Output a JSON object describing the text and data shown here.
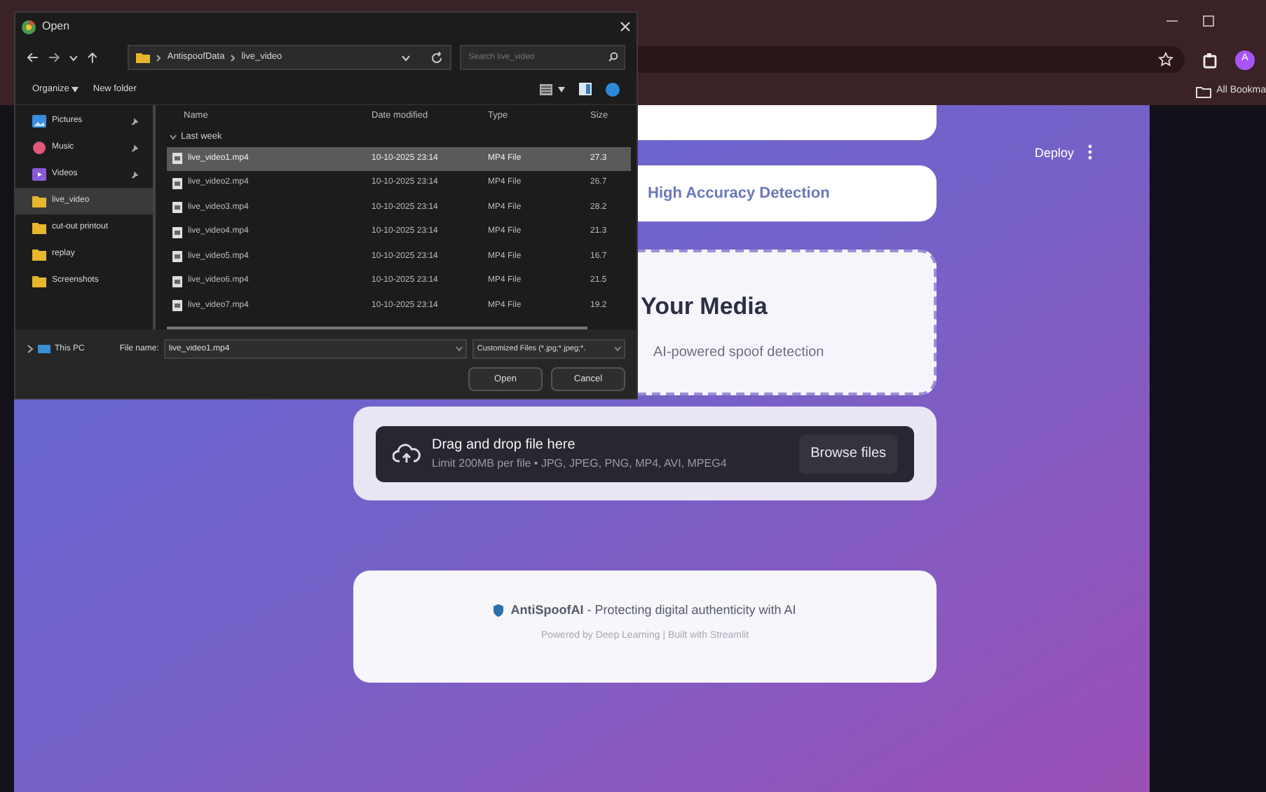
{
  "browser": {
    "bookmarks": "All Bookma",
    "profile": "A"
  },
  "app": {
    "deploy": "Deploy",
    "feature": "High Accuracy Detection",
    "upload_title": "Your Media",
    "upload_subtitle": "AI-powered spoof detection",
    "dropzone": {
      "title": "Drag and drop file here",
      "hint": "Limit 200MB per file • JPG, JPEG, PNG, MP4, AVI, MPEG4",
      "button": "Browse files"
    },
    "footer": {
      "line": "**AntiSpoofAI** - Protecting digital authenticity with AI",
      "credits": "Powered by Deep Learning | Built with Streamlit"
    }
  },
  "dialog": {
    "title": "Open",
    "breadcrumb": [
      "AntispoofData",
      "live_video"
    ],
    "search": {
      "placeholder": "Search live_video"
    },
    "toolbar": {
      "organize": "Organize",
      "new_folder": "New folder"
    },
    "nav": [
      {
        "label": "Pictures",
        "kind": "pictures",
        "pinned": true,
        "selected": false
      },
      {
        "label": "Music",
        "kind": "music",
        "pinned": true,
        "selected": false
      },
      {
        "label": "Videos",
        "kind": "videos",
        "pinned": true,
        "selected": false
      },
      {
        "label": "live_video",
        "kind": "folder",
        "pinned": false,
        "selected": true
      },
      {
        "label": "cut-out printout",
        "kind": "folder",
        "pinned": false,
        "selected": false
      },
      {
        "label": "replay",
        "kind": "folder",
        "pinned": false,
        "selected": false
      },
      {
        "label": "Screenshots",
        "kind": "folder",
        "pinned": false,
        "selected": false
      }
    ],
    "this_pc": {
      "label": "This PC",
      "expanded": false
    },
    "columns": [
      "Name",
      "Date modified",
      "Type",
      "Size"
    ],
    "group": "Last week",
    "files": [
      {
        "name": "live_video1.mp4",
        "date": "10-10-2025 23:14",
        "type": "MP4 File",
        "size": "27.3",
        "selected": true
      },
      {
        "name": "live_video2.mp4",
        "date": "10-10-2025 23:14",
        "type": "MP4 File",
        "size": "26.7",
        "selected": false
      },
      {
        "name": "live_video3.mp4",
        "date": "10-10-2025 23:14",
        "type": "MP4 File",
        "size": "28.2",
        "selected": false
      },
      {
        "name": "live_video4.mp4",
        "date": "10-10-2025 23:14",
        "type": "MP4 File",
        "size": "21.3",
        "selected": false
      },
      {
        "name": "live_video5.mp4",
        "date": "10-10-2025 23:14",
        "type": "MP4 File",
        "size": "16.7",
        "selected": false
      },
      {
        "name": "live_video6.mp4",
        "date": "10-10-2025 23:14",
        "type": "MP4 File",
        "size": "21.5",
        "selected": false
      },
      {
        "name": "live_video7.mp4",
        "date": "10-10-2025 23:14",
        "type": "MP4 File",
        "size": "19.2",
        "selected": false
      }
    ],
    "file_name_label": "File name:",
    "file_name": "live_video1.mp4",
    "file_type": "Customized Files (*.jpg;*.jpeg;*.",
    "buttons": [
      "Open",
      "Cancel"
    ]
  }
}
